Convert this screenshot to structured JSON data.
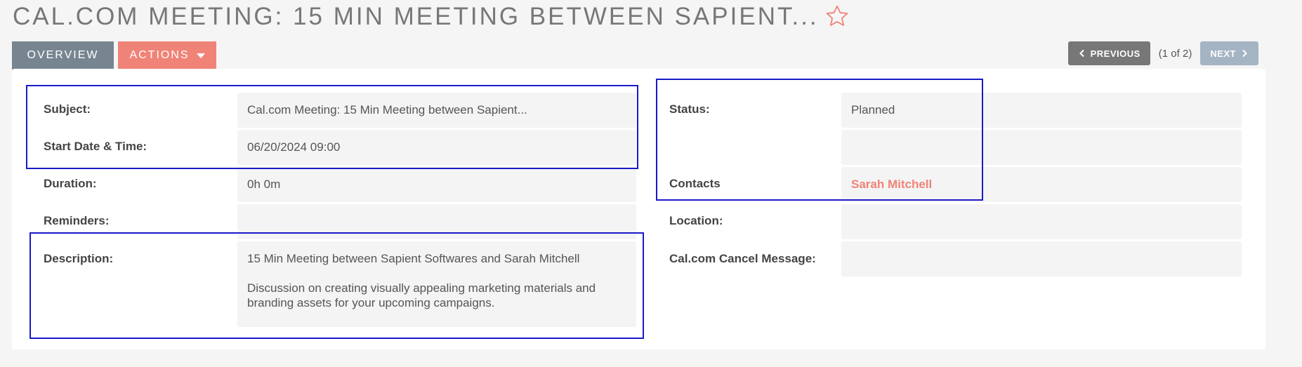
{
  "header": {
    "title": "CAL.COM MEETING: 15 MIN MEETING BETWEEN SAPIENT...",
    "favorite_icon": "star-outline-icon"
  },
  "tabs": [
    {
      "label": "OVERVIEW"
    },
    {
      "label": "ACTIONS"
    }
  ],
  "pager": {
    "previous_label": "PREVIOUS",
    "count": "(1 of 2)",
    "next_label": "NEXT"
  },
  "left_fields": {
    "subject": {
      "label": "Subject:",
      "value": "Cal.com Meeting: 15 Min Meeting between Sapient..."
    },
    "start": {
      "label": "Start Date & Time:",
      "value": "06/20/2024 09:00"
    },
    "duration": {
      "label": "Duration:",
      "value": "0h 0m"
    },
    "reminders": {
      "label": "Reminders:",
      "value": ""
    },
    "description": {
      "label": "Description:",
      "line1": "15 Min Meeting between Sapient Softwares and Sarah Mitchell",
      "line2": "Discussion on creating visually appealing marketing materials and branding assets for your upcoming campaigns."
    }
  },
  "right_fields": {
    "status": {
      "label": "Status:",
      "value": "Planned"
    },
    "contacts": {
      "label": "Contacts",
      "value": "Sarah Mitchell"
    },
    "location": {
      "label": "Location:",
      "value": ""
    },
    "cancel_message": {
      "label": "Cal.com Cancel Message:",
      "value": ""
    }
  },
  "colors": {
    "accent": "#f08377",
    "tab_active": "#778591",
    "highlight_border": "#1a1ac8"
  }
}
